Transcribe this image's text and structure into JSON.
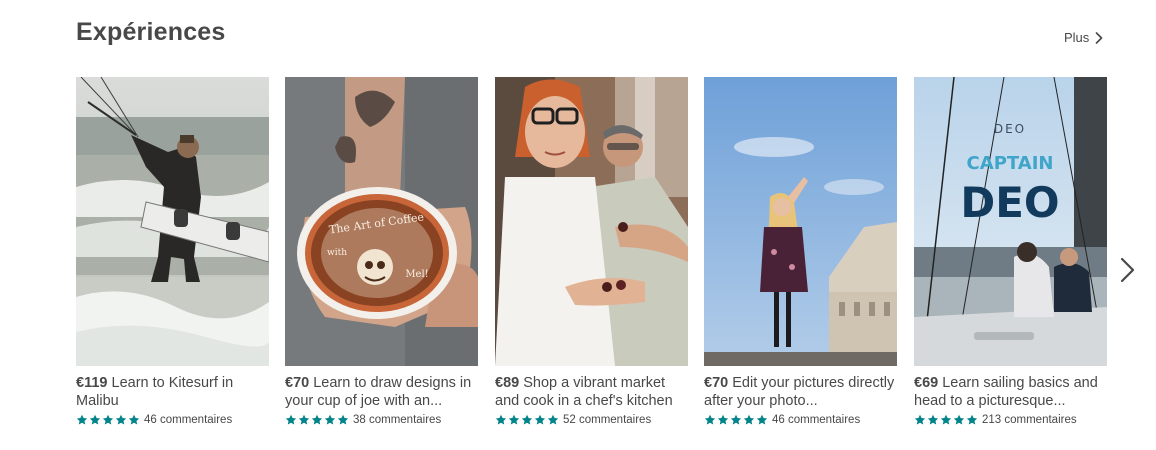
{
  "section": {
    "title": "Expériences",
    "more_label": "Plus"
  },
  "theme": {
    "text_color": "#484848",
    "star_color": "#008489"
  },
  "cards": [
    {
      "price": "€119",
      "title": "Learn to Kitesurf in Malibu",
      "rating": 5,
      "reviews": "46 commentaires",
      "image": "kitesurfer-photo"
    },
    {
      "price": "€70",
      "title": "Learn to draw designs in your cup of joe with an...",
      "rating": 5,
      "reviews": "38 commentaires",
      "image": "latte-art-photo",
      "image_text": [
        "The Art of Coffee",
        "with",
        "Mel!"
      ]
    },
    {
      "price": "€89",
      "title": "Shop a vibrant market and cook in a chef's kitchen",
      "rating": 5,
      "reviews": "52 commentaires",
      "image": "market-cooking-photo"
    },
    {
      "price": "€70",
      "title": "Edit your pictures directly after your photo...",
      "rating": 5,
      "reviews": "46 commentaires",
      "image": "paris-photoshoot-photo"
    },
    {
      "price": "€69",
      "title": "Learn sailing basics and head to a picturesque...",
      "rating": 5,
      "reviews": "213 commentaires",
      "image": "sailing-photo",
      "image_text": [
        "DEO",
        "CAPTAIN",
        "DEO"
      ]
    }
  ]
}
